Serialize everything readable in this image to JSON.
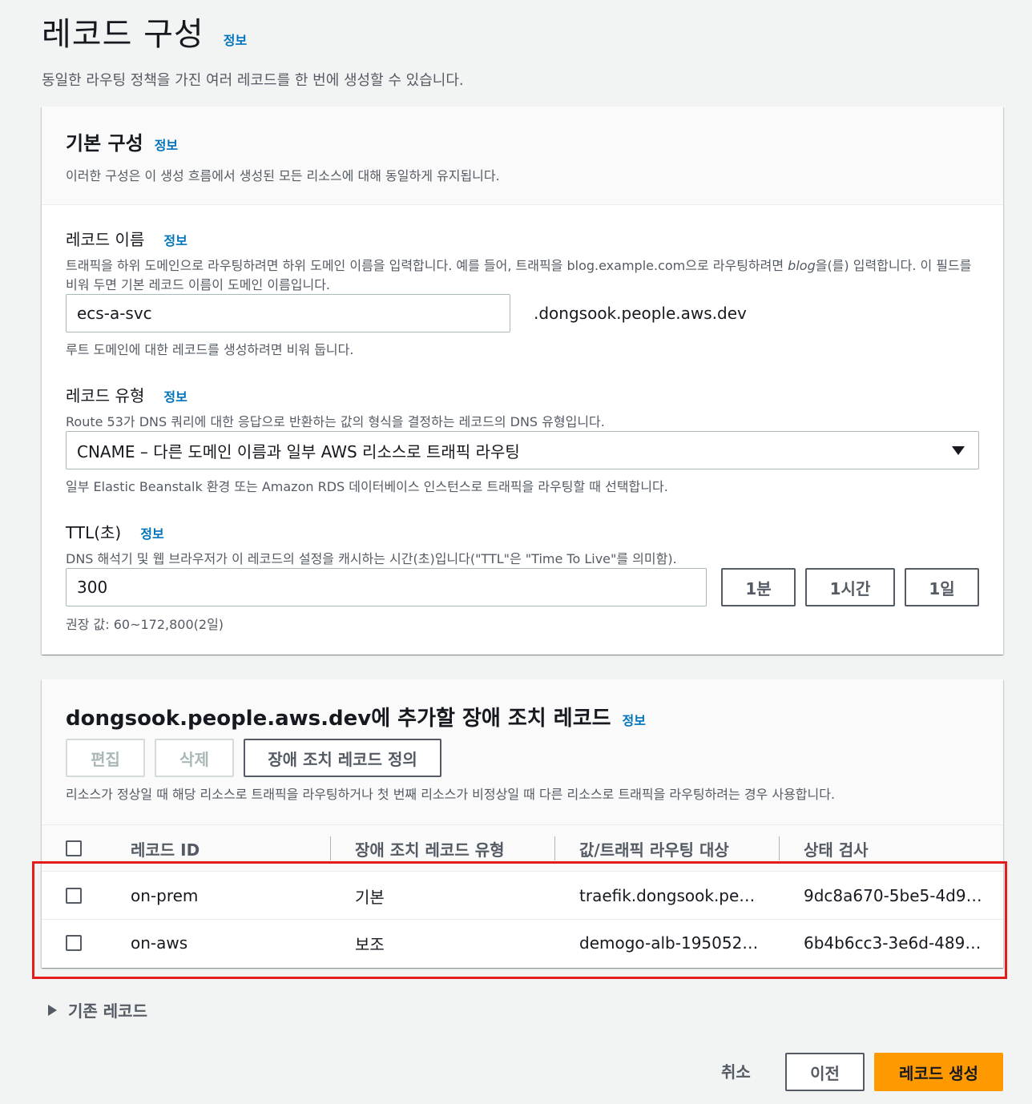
{
  "header": {
    "title": "레코드 구성",
    "info": "정보",
    "description": "동일한 라우팅 정책을 가진 여러 레코드를 한 번에 생성할 수 있습니다."
  },
  "basic": {
    "title": "기본 구성",
    "info": "정보",
    "description": "이러한 구성은 이 생성 흐름에서 생성된 모든 리소스에 대해 동일하게 유지됩니다."
  },
  "record_name": {
    "label": "레코드 이름",
    "info": "정보",
    "desc_before": "트래픽을 하위 도메인으로 라우팅하려면 하위 도메인 이름을 입력합니다. 예를 들어, 트래픽을 blog.example.com으로 라우팅하려면 ",
    "desc_em": "blog",
    "desc_after": "을(를) 입력합니다. 이 필드를 비워 두면 기본 레코드 이름이 도메인 이름입니다.",
    "value": "ecs-a-svc",
    "domain_suffix": ".dongsook.people.aws.dev",
    "constraint": "루트 도메인에 대한 레코드를 생성하려면 비워 둡니다."
  },
  "record_type": {
    "label": "레코드 유형",
    "info": "정보",
    "description": "Route 53가 DNS 쿼리에 대한 응답으로 반환하는 값의 형식을 결정하는 레코드의 DNS 유형입니다.",
    "selected": "CNAME – 다른 도메인 이름과 일부 AWS 리소스로 트래픽 라우팅",
    "constraint": "일부 Elastic Beanstalk 환경 또는 Amazon RDS 데이터베이스 인스턴스로 트래픽을 라우팅할 때 선택합니다."
  },
  "ttl": {
    "label": "TTL(초)",
    "info": "정보",
    "description": "DNS 해석기 및 웹 브라우저가 이 레코드의 설정을 캐시하는 시간(초)입니다(\"TTL\"은 \"Time To Live\"를 의미함).",
    "value": "300",
    "btn_1m": "1분",
    "btn_1h": "1시간",
    "btn_1d": "1일",
    "constraint": "권장 값: 60~172,800(2일)"
  },
  "failover": {
    "title": "dongsook.people.aws.dev에 추가할 장애 조치 레코드",
    "info": "정보",
    "edit": "편집",
    "delete": "삭제",
    "define": "장애 조치 레코드 정의",
    "description": "리소스가 정상일 때 해당 리소스로 트래픽을 라우팅하거나 첫 번째 리소스가 비정상일 때 다른 리소스로 트래픽을 라우팅하려는 경우 사용합니다.",
    "columns": [
      "레코드 ID",
      "장애 조치 레코드 유형",
      "값/트래픽 라우팅 대상",
      "상태 검사"
    ],
    "rows": [
      [
        "on-prem",
        "기본",
        "traefik.dongsook.pe…",
        "9dc8a670-5be5-4d9…"
      ],
      [
        "on-aws",
        "보조",
        "demogo-alb-195052…",
        "6b4b6cc3-3e6d-489…"
      ]
    ]
  },
  "existing_records": "기존 레코드",
  "footer": {
    "cancel": "취소",
    "previous": "이전",
    "create": "레코드 생성"
  },
  "colors": {
    "info_link": "#0073bb",
    "primary": "#ff9900",
    "highlight": "#e41c1c"
  }
}
